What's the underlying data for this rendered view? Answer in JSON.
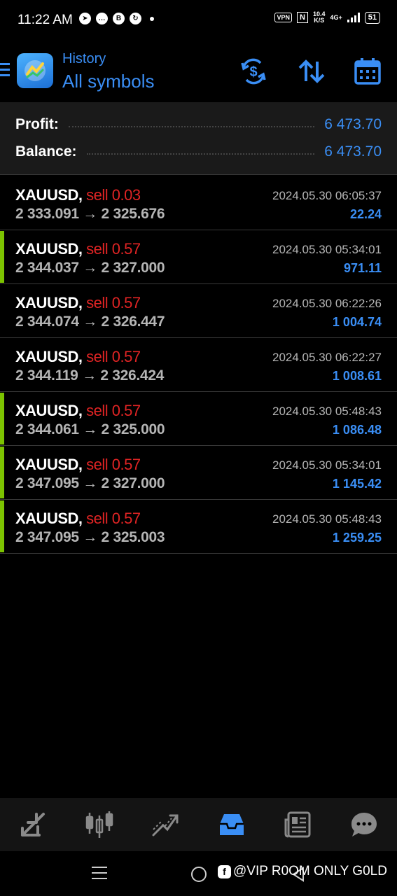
{
  "status_bar": {
    "time": "11:22 AM",
    "vpn": "VPN",
    "nfc": "N",
    "speed_value": "10.4",
    "speed_unit": "K/S",
    "network": "4G+",
    "battery": "51"
  },
  "header": {
    "subtitle": "History",
    "title": "All symbols"
  },
  "summary": {
    "profit_label": "Profit:",
    "profit_value": "6 473.70",
    "balance_label": "Balance:",
    "balance_value": "6 473.70"
  },
  "trades": [
    {
      "symbol": "XAUUSD,",
      "type": "sell 0.03",
      "open": "2 333.091",
      "close": "2 325.676",
      "time": "2024.05.30 06:05:37",
      "profit": "22.24"
    },
    {
      "symbol": "XAUUSD,",
      "type": "sell 0.57",
      "open": "2 344.037",
      "close": "2 327.000",
      "time": "2024.05.30 05:34:01",
      "profit": "971.11"
    },
    {
      "symbol": "XAUUSD,",
      "type": "sell 0.57",
      "open": "2 344.074",
      "close": "2 326.447",
      "time": "2024.05.30 06:22:26",
      "profit": "1 004.74"
    },
    {
      "symbol": "XAUUSD,",
      "type": "sell 0.57",
      "open": "2 344.119",
      "close": "2 326.424",
      "time": "2024.05.30 06:22:27",
      "profit": "1 008.61"
    },
    {
      "symbol": "XAUUSD,",
      "type": "sell 0.57",
      "open": "2 344.061",
      "close": "2 325.000",
      "time": "2024.05.30 05:48:43",
      "profit": "1 086.48"
    },
    {
      "symbol": "XAUUSD,",
      "type": "sell 0.57",
      "open": "2 347.095",
      "close": "2 327.000",
      "time": "2024.05.30 05:34:01",
      "profit": "1 145.42"
    },
    {
      "symbol": "XAUUSD,",
      "type": "sell 0.57",
      "open": "2 347.095",
      "close": "2 325.003",
      "time": "2024.05.30 05:48:43",
      "profit": "1 259.25"
    }
  ],
  "arrow": "→",
  "colors": {
    "accent": "#3a8ef5",
    "sell": "#e02424",
    "marker": "#7cc300"
  },
  "bottom_nav": [
    "quotes-icon",
    "chart-icon",
    "trade-icon",
    "history-icon",
    "news-icon",
    "messages-icon"
  ],
  "watermark": "@VIP R0OM ONLY G0LD"
}
